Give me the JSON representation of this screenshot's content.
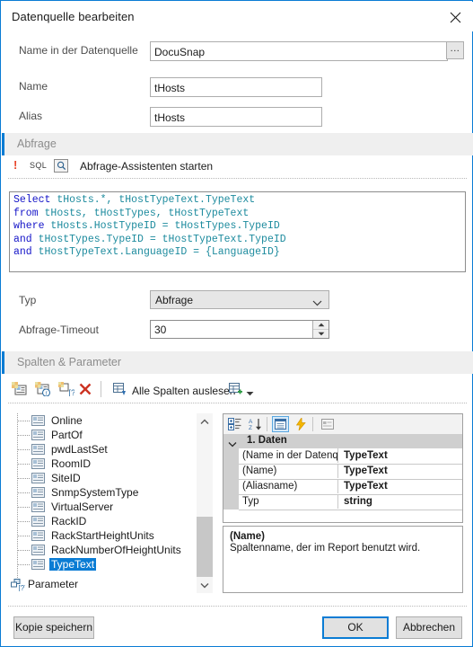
{
  "window": {
    "title": "Datenquelle bearbeiten",
    "close_icon": "close-icon",
    "border_color": "#0a7cd4"
  },
  "fields": [
    {
      "label": "Name in der Datenquelle",
      "value": "DocuSnap",
      "has_browse": true,
      "browse_label": "..."
    },
    {
      "label": "Name",
      "value": "tHosts",
      "has_browse": false
    },
    {
      "label": "Alias",
      "value": "tHosts",
      "has_browse": false
    }
  ],
  "query_section": {
    "title": "Abfrage",
    "warn_icon": "warning-exclamation-icon",
    "sql_icon_label": "SQL",
    "magnifier_icon": "magnifier-icon",
    "wizard_link": "Abfrage-Assistenten starten",
    "sql_lines": [
      {
        "keyword": "Select",
        "rest": " tHosts.*, tHostTypeText.TypeText"
      },
      {
        "keyword": "from",
        "rest": " tHosts, tHostTypes, tHostTypeText"
      },
      {
        "keyword": "where",
        "rest": " tHosts.HostTypeID = tHostTypes.TypeID"
      },
      {
        "keyword": "and",
        "rest": " tHostTypes.TypeID = tHostTypeText.TypeID"
      },
      {
        "keyword": "and",
        "rest": " tHostTypeText.LanguageID = {LanguageID}"
      }
    ],
    "type_label": "Typ",
    "type_value": "Abfrage",
    "type_options": [
      "Abfrage"
    ],
    "timeout_label": "Abfrage-Timeout",
    "timeout_value": "30"
  },
  "columns_section": {
    "title": "Spalten & Parameter",
    "toolbar": {
      "icons": [
        {
          "name": "add-column-icon"
        },
        {
          "name": "add-function-column-icon"
        },
        {
          "name": "add-parameter-icon"
        },
        {
          "name": "delete-column-icon"
        }
      ],
      "read_all_label": "Alle Spalten auslesen",
      "read_all_icon": "table-down-icon",
      "add_table_icon": "table-add-icon",
      "dropdown_icon": "chevron-down-icon"
    },
    "tree": {
      "items": [
        {
          "label": "Online",
          "selected": false
        },
        {
          "label": "PartOf",
          "selected": false
        },
        {
          "label": "pwdLastSet",
          "selected": false
        },
        {
          "label": "RoomID",
          "selected": false
        },
        {
          "label": "SiteID",
          "selected": false
        },
        {
          "label": "SnmpSystemType",
          "selected": false
        },
        {
          "label": "VirtualServer",
          "selected": false
        },
        {
          "label": "RackID",
          "selected": false
        },
        {
          "label": "RackStartHeightUnits",
          "selected": false
        },
        {
          "label": "RackNumberOfHeightUnits",
          "selected": false
        },
        {
          "label": "TypeText",
          "selected": true
        }
      ],
      "parameter_node": "Parameter",
      "scroll_up_icon": "chevron-up-icon",
      "scroll_down_icon": "chevron-down-icon"
    },
    "property_grid": {
      "toolbar_buttons": [
        {
          "name": "categorized-view-icon",
          "active": false
        },
        {
          "name": "alphabetical-sort-icon",
          "active": false
        },
        {
          "name": "properties-icon",
          "active": true
        },
        {
          "name": "events-lightning-icon",
          "active": false
        },
        {
          "name": "property-pages-icon",
          "active": false
        }
      ],
      "category": "1. Daten",
      "category_expand_icon": "chevron-down-icon",
      "rows": [
        {
          "name": "(Name in der Datenquelle)",
          "value": "TypeText"
        },
        {
          "name": "(Name)",
          "value": "TypeText"
        },
        {
          "name": "(Aliasname)",
          "value": "TypeText"
        },
        {
          "name": "Typ",
          "value": "string"
        }
      ]
    },
    "description": {
      "title": "(Name)",
      "text": "Spaltenname, der im Report benutzt wird."
    }
  },
  "footer": {
    "save_copy_label": "Kopie speichern",
    "ok_label": "OK",
    "cancel_label": "Abbrechen"
  }
}
